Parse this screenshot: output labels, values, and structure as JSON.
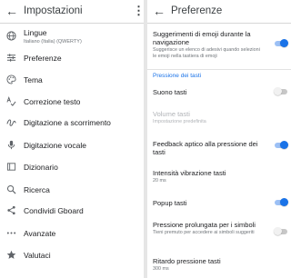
{
  "left": {
    "title": "Impostazioni",
    "back_icon": "arrow-back-icon",
    "menu_icon": "more-vert-icon",
    "items": [
      {
        "label": "Lingue",
        "sub": "Italiano (Italia) (QWERTY)",
        "icon": "globe-icon"
      },
      {
        "label": "Preferenze",
        "icon": "sliders-icon"
      },
      {
        "label": "Tema",
        "icon": "palette-icon"
      },
      {
        "label": "Correzione testo",
        "icon": "spellcheck-icon"
      },
      {
        "label": "Digitazione a scorrimento",
        "icon": "gesture-icon"
      },
      {
        "label": "Digitazione vocale",
        "icon": "microphone-icon"
      },
      {
        "label": "Dizionario",
        "icon": "book-icon"
      },
      {
        "label": "Ricerca",
        "icon": "search-icon"
      },
      {
        "label": "Condividi Gboard",
        "icon": "share-icon"
      },
      {
        "label": "Avanzate",
        "icon": "more-horiz-icon"
      },
      {
        "label": "Valutaci",
        "icon": "star-icon"
      }
    ]
  },
  "right": {
    "title": "Preferenze",
    "back_icon": "arrow-back-icon",
    "emoji": {
      "title": "Suggerimenti di emoji durante la navigazione",
      "sub": "Suggerisce un elenco di adesivi quando selezioni le emoji nella tastiera di emoji",
      "on": true
    },
    "section_title": "Pressione dei tasti",
    "suono": {
      "title": "Suono tasti",
      "on": false
    },
    "volume": {
      "title": "Volume tasti",
      "sub": "Impostazione predefinita"
    },
    "feedback": {
      "title": "Feedback aptico alla pressione dei tasti",
      "on": true
    },
    "intensita": {
      "title": "Intensità vibrazione tasti",
      "sub": "20 ms"
    },
    "popup": {
      "title": "Popup tasti",
      "on": true
    },
    "pressione": {
      "title": "Pressione prolungata per i simboli",
      "sub": "Tieni premuto per accedere ai simboli suggeriti",
      "on": false
    },
    "ritardo": {
      "title": "Ritardo pressione tasti",
      "sub": "300 ms"
    }
  },
  "colors": {
    "accent": "#1a73e8",
    "toggle_on_track": "#9cc0f5",
    "toggle_off_track": "#c7c7c7"
  }
}
